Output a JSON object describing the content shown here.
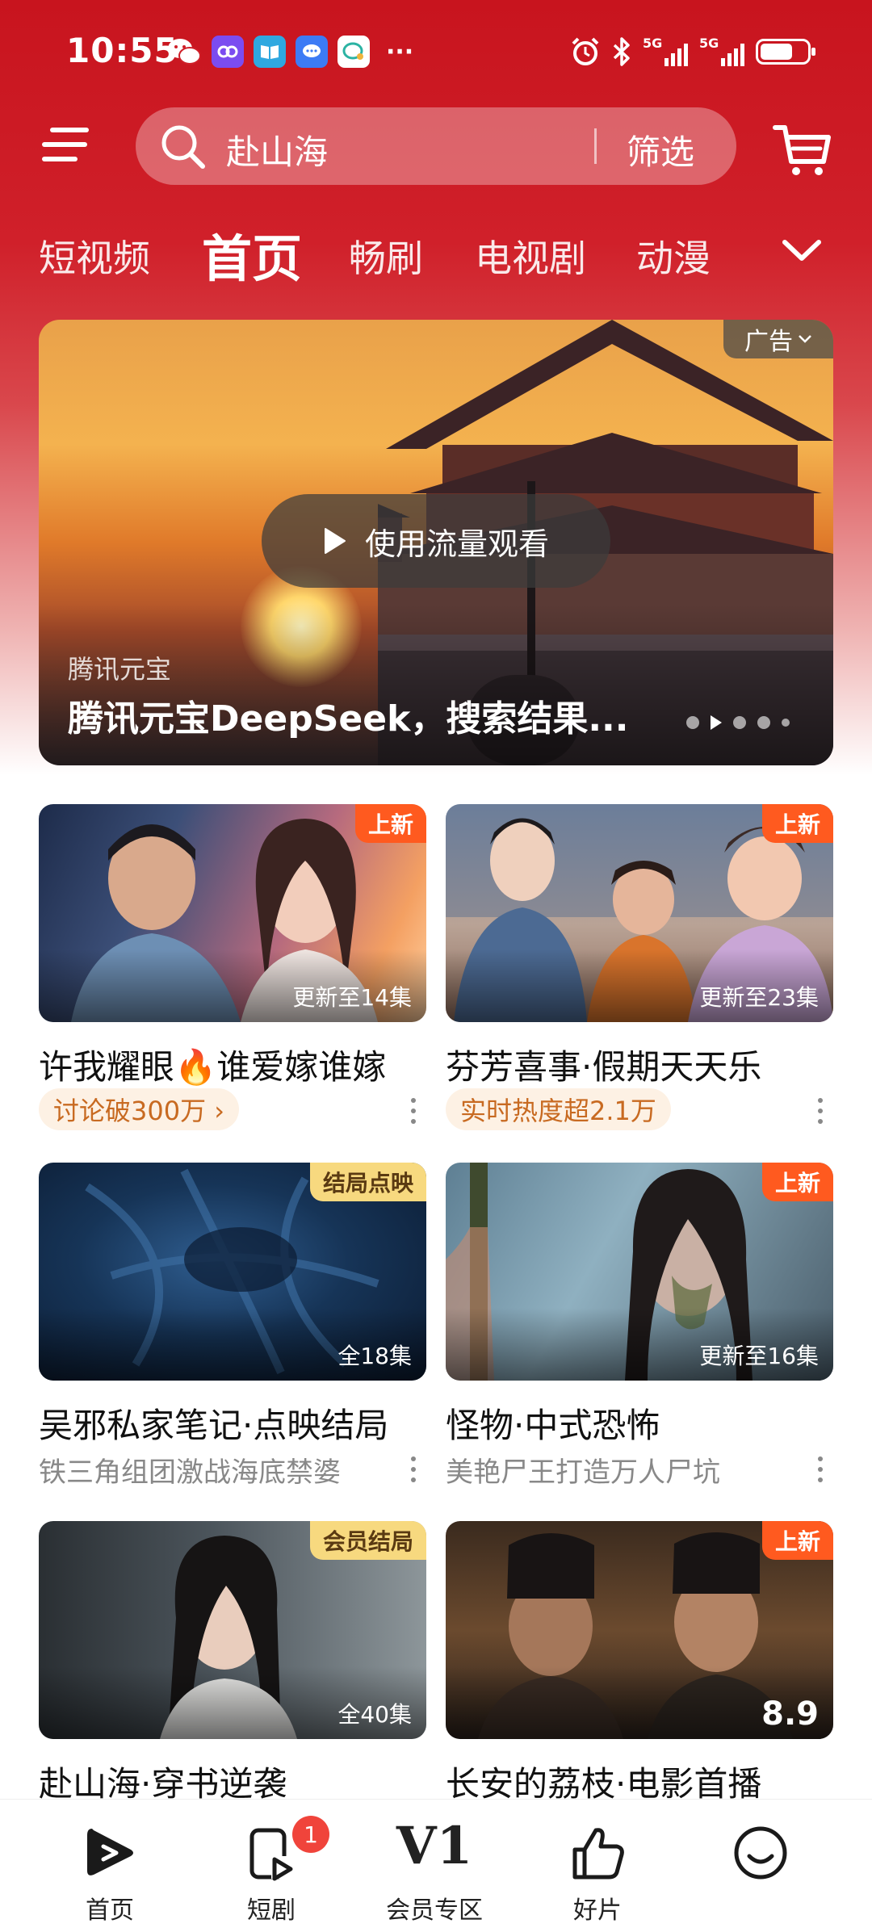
{
  "status_bar": {
    "time": "10:55",
    "signal_labels": [
      "5G",
      "5G"
    ],
    "battery_level": 0.7
  },
  "header": {
    "search_text": "赴山海",
    "filter_label": "筛选"
  },
  "tabs": [
    "短视频",
    "首页",
    "畅刷",
    "电视剧",
    "动漫"
  ],
  "active_tab": "首页",
  "banner": {
    "ad_label": "广告",
    "play_label": "使用流量观看",
    "source": "腾讯元宝",
    "title": "腾讯元宝DeepSeek，搜索结果...",
    "page_count": 5,
    "current_page": 2
  },
  "cards": [
    {
      "title": "许我耀眼🔥谁爱嫁谁嫁",
      "badge": "上新",
      "episodes": "更新至14集",
      "tag": "讨论破300万 ›"
    },
    {
      "title": "芬芳喜事·假期天天乐",
      "badge": "上新",
      "episodes": "更新至23集",
      "tag": "实时热度超2.1万"
    },
    {
      "title": "吴邪私家笔记·点映结局",
      "badge": "结局点映",
      "episodes": "全18集",
      "subtitle": "铁三角组团激战海底禁婆"
    },
    {
      "title": "怪物·中式恐怖",
      "badge": "上新",
      "episodes": "更新至16集",
      "subtitle": "美艳尸王打造万人尸坑"
    },
    {
      "title": "赴山海·穿书逆袭",
      "badge": "会员结局",
      "episodes": "全40集"
    },
    {
      "title": "长安的荔枝·电影首播",
      "badge": "上新",
      "score": "8.9"
    }
  ],
  "bottom_nav": {
    "home": "首页",
    "short_drama": "短剧",
    "short_drama_badge": "1",
    "vip_icon": "V1",
    "vip": "会员专区",
    "recommend": "好片",
    "profile_icon": "smiley-icon"
  },
  "colors": {
    "brand_red": "#c8141e",
    "badge_orange": "#ff5a1f",
    "badge_yellow": "#f7d97f",
    "nav_badge": "#f0443b"
  }
}
